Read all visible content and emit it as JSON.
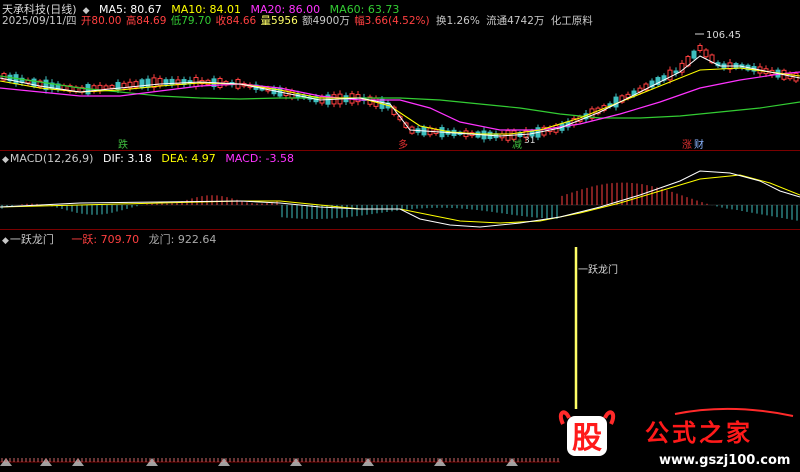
{
  "header": {
    "stock_name": "天承科技(日线)",
    "ma5": "MA5: 80.67",
    "ma10": "MA10: 84.01",
    "ma20": "MA20: 86.00",
    "ma60": "MA60: 63.73",
    "date": "2025/09/11/四",
    "open": "开80.00",
    "high": "高84.69",
    "low": "低79.70",
    "close": "收84.66",
    "volume": "量5956",
    "amount": "额4900万",
    "change": "幅3.66(4.52%)",
    "turnover": "换1.26%",
    "float": "流通4742万",
    "sector": "化工原料"
  },
  "price_panel": {
    "peak_label": "106.45",
    "low_label": "31",
    "markers": [
      {
        "text": "跌",
        "color": "#3fbf3f"
      },
      {
        "text": "多",
        "color": "#e03030"
      },
      {
        "text": "减",
        "color": "#3fbf3f"
      },
      {
        "text": "涨",
        "color": "#e03030"
      },
      {
        "text": "财",
        "color": "#8ab4ff"
      }
    ]
  },
  "macd": {
    "title": "MACD(12,26,9)",
    "dif": "DIF: 3.18",
    "dea": "DEA: 4.97",
    "macd": "MACD: -3.58"
  },
  "ylm": {
    "title": "一跃龙门",
    "val1": "一跃: 709.70",
    "val2": "龙门: 922.64",
    "signal_label": "一跃龙门"
  },
  "logo": {
    "char": "股",
    "text": "公式之家",
    "url": "www.gszj100.com"
  },
  "colors": {
    "ma5": "#ffffff",
    "ma10": "#ffff00",
    "ma20": "#ff33ff",
    "ma60": "#33cc33",
    "up": "#ff4040",
    "down": "#3fbfbf",
    "signal": "#ffff66"
  }
}
